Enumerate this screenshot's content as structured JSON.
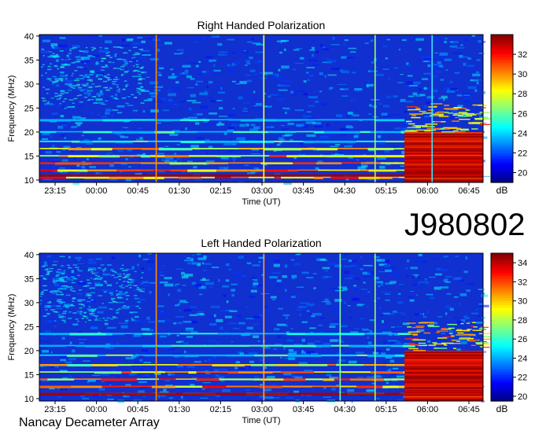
{
  "identifier": "J980802",
  "footer_label": "Nancay Decameter Array",
  "chart_data": [
    {
      "type": "heatmap",
      "title": "Right Handed Polarization",
      "xlabel": "Time (UT)",
      "ylabel": "Frequency (MHz)",
      "x_ticks": [
        "23:15",
        "00:00",
        "00:45",
        "01:30",
        "02:15",
        "03:00",
        "03:45",
        "04:30",
        "05:15",
        "06:00",
        "06:45"
      ],
      "y_ticks": [
        10,
        15,
        20,
        25,
        30,
        35,
        40
      ],
      "ylim": [
        10,
        40
      ],
      "colorbar": {
        "label": "dB",
        "range": [
          19,
          34
        ],
        "ticks": [
          20,
          22,
          24,
          26,
          28,
          30,
          32
        ]
      },
      "bursts": [
        {
          "time": "01:05",
          "color": "#ff8c00"
        },
        {
          "time": "03:02",
          "color": "#ffff40"
        },
        {
          "time": "05:03",
          "color": "#a0ff60"
        },
        {
          "time": "06:05",
          "color": "#40e0ff"
        }
      ],
      "emission_bands_mhz": [
        10.5,
        12,
        13.5,
        15,
        16.5,
        18,
        20,
        22.5
      ],
      "strong_emission_after": "05:35"
    },
    {
      "type": "heatmap",
      "title": "Left Handed Polarization",
      "xlabel": "Time (UT)",
      "ylabel": "Frequency (MHz)",
      "x_ticks": [
        "23:15",
        "00:00",
        "00:45",
        "01:30",
        "02:15",
        "03:00",
        "03:45",
        "04:30",
        "05:15",
        "06:00",
        "06:45"
      ],
      "y_ticks": [
        10,
        15,
        20,
        25,
        30,
        35,
        40
      ],
      "ylim": [
        10,
        40
      ],
      "colorbar": {
        "label": "dB",
        "range": [
          19.5,
          35
        ],
        "ticks": [
          20,
          22,
          24,
          26,
          28,
          30,
          32,
          34
        ]
      },
      "bursts": [
        {
          "time": "01:05",
          "color": "#ff8c00"
        },
        {
          "time": "03:02",
          "color": "#ffa040"
        },
        {
          "time": "04:25",
          "color": "#80ffa0"
        },
        {
          "time": "05:03",
          "color": "#a0ff60"
        }
      ],
      "emission_bands_mhz": [
        11,
        12.5,
        14,
        15.5,
        17,
        19,
        21,
        23.5
      ],
      "strong_emission_after": "05:35"
    }
  ]
}
